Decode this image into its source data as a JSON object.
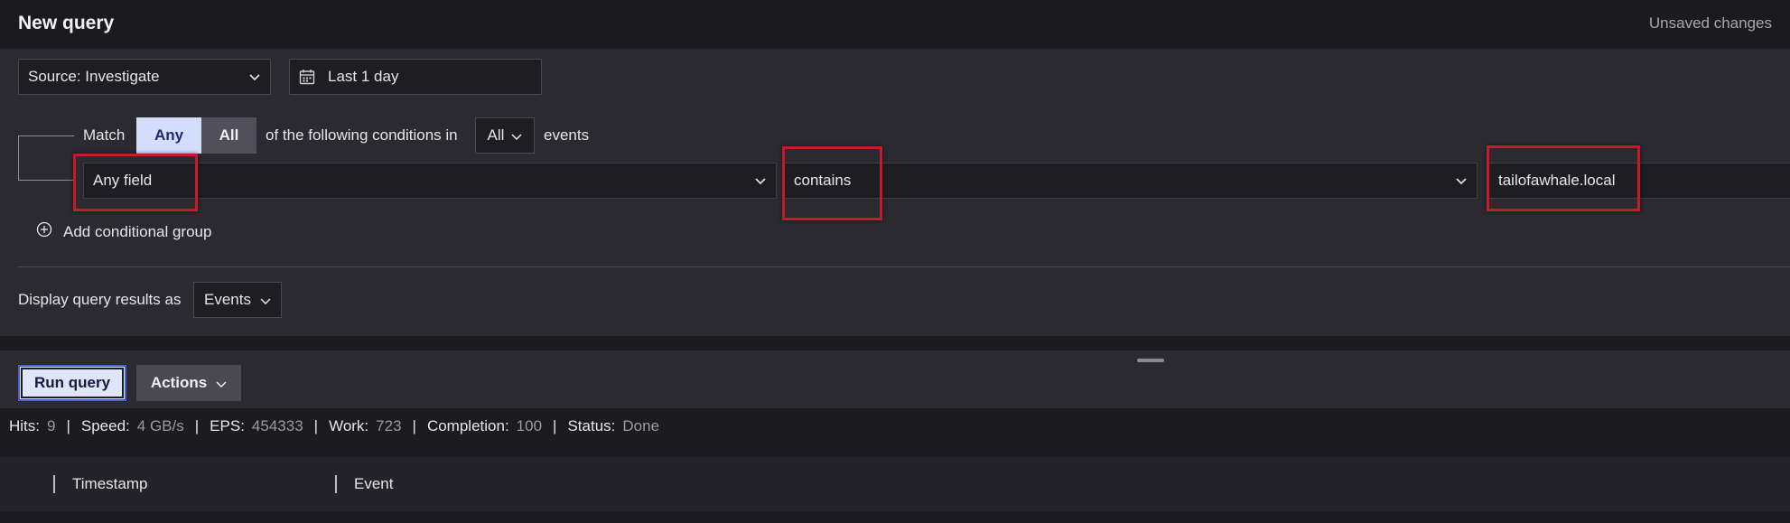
{
  "header": {
    "title": "New query",
    "status": "Unsaved changes"
  },
  "source": {
    "select_label": "Source: Investigate",
    "date_label": "Last 1 day"
  },
  "conditions": {
    "match_label": "Match",
    "any_label": "Any",
    "all_label": "All",
    "following_label": "of the following conditions in",
    "scope_value": "All",
    "events_label": "events",
    "field_value": "Any field",
    "operator_value": "contains",
    "value_text": "tailofawhale.local",
    "add_group_label": "Add conditional group"
  },
  "display": {
    "label": "Display query results as",
    "value": "Events"
  },
  "toolbar": {
    "run_label": "Run query",
    "actions_label": "Actions"
  },
  "stats": [
    {
      "key": "Hits:",
      "value": "9"
    },
    {
      "key": "Speed:",
      "value": "4 GB/s"
    },
    {
      "key": "EPS:",
      "value": "454333"
    },
    {
      "key": "Work:",
      "value": "723"
    },
    {
      "key": "Completion:",
      "value": "100"
    },
    {
      "key": "Status:",
      "value": "Done"
    }
  ],
  "table": {
    "columns": [
      "Timestamp",
      "Event"
    ]
  },
  "colors": {
    "highlight": "#c8192a",
    "accent": "#d4defc",
    "background": "#1c1b1f"
  }
}
